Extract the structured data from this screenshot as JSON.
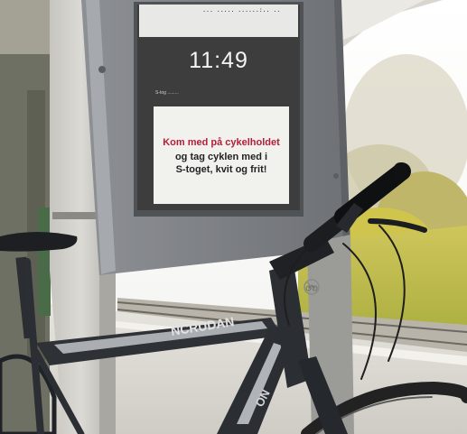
{
  "screen": {
    "top_band": "... ..... ......:.. ..",
    "clock": "11:49",
    "status_line": "S-tog .........",
    "message": {
      "line1": "Kom med på cykelholdet",
      "line2": "og tag cyklen med i",
      "line3": "S-toget, kvit og frit!"
    },
    "icon": "no-bicycle-sign-icon"
  },
  "colors": {
    "message_headline": "#b41e37",
    "message_text": "#222222",
    "screen_dark": "#3d3d3d",
    "housing": "#7b7e82",
    "bicycle_frame": "#2b2e33",
    "grass": "#c9c23a"
  }
}
